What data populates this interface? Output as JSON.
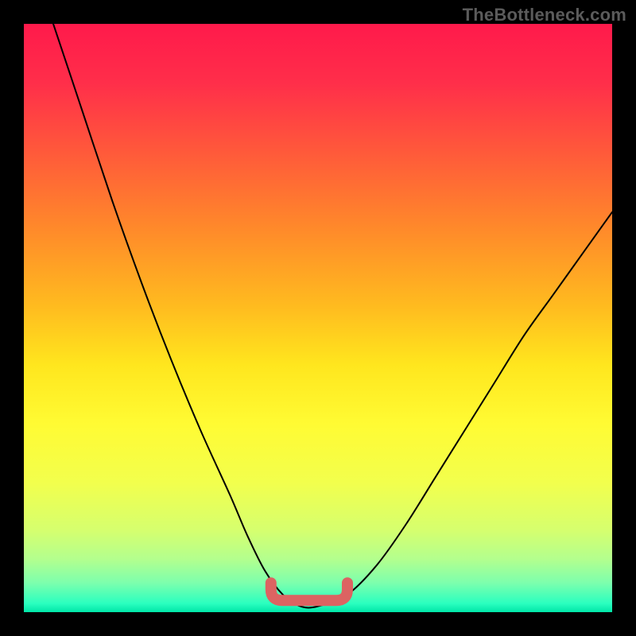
{
  "watermark": "TheBottleneck.com",
  "colors": {
    "bg": "#000000",
    "curve": "#000000",
    "marker": "#dc6362",
    "gradient_stops": [
      {
        "offset": 0.0,
        "color": "#ff1a4b"
      },
      {
        "offset": 0.1,
        "color": "#ff2e4a"
      },
      {
        "offset": 0.22,
        "color": "#ff5a3a"
      },
      {
        "offset": 0.35,
        "color": "#ff8a2a"
      },
      {
        "offset": 0.48,
        "color": "#ffbb1f"
      },
      {
        "offset": 0.58,
        "color": "#ffe61e"
      },
      {
        "offset": 0.68,
        "color": "#fffb33"
      },
      {
        "offset": 0.78,
        "color": "#f2ff4d"
      },
      {
        "offset": 0.86,
        "color": "#d6ff6e"
      },
      {
        "offset": 0.91,
        "color": "#b3ff8e"
      },
      {
        "offset": 0.95,
        "color": "#7dffad"
      },
      {
        "offset": 0.985,
        "color": "#2bffbf"
      },
      {
        "offset": 1.0,
        "color": "#00e6a8"
      }
    ]
  },
  "chart_data": {
    "type": "line",
    "title": "",
    "xlabel": "",
    "ylabel": "",
    "xlim": [
      0,
      100
    ],
    "ylim": [
      0,
      100
    ],
    "series": [
      {
        "name": "bottleneck-curve",
        "x": [
          5,
          10,
          15,
          20,
          25,
          30,
          35,
          38,
          41,
          44,
          47,
          50,
          55,
          60,
          65,
          70,
          75,
          80,
          85,
          90,
          95,
          100
        ],
        "y": [
          100,
          85,
          70,
          56,
          43,
          31,
          20,
          13,
          7,
          3,
          1,
          1,
          3,
          8,
          15,
          23,
          31,
          39,
          47,
          54,
          61,
          68
        ]
      }
    ],
    "annotations": [
      {
        "name": "valley-marker",
        "shape": "flat-u",
        "x_range": [
          42,
          55
        ],
        "y": 2
      }
    ]
  }
}
